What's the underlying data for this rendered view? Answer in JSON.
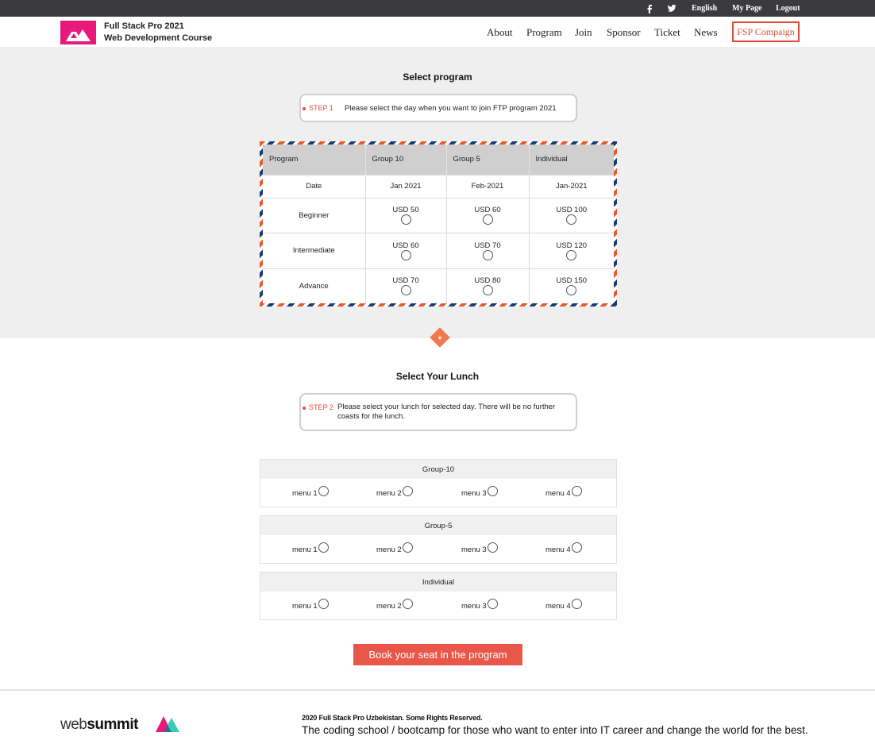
{
  "topbar": {
    "social_icons": [
      "facebook-icon",
      "twitter-icon"
    ],
    "language": "English",
    "my_page": "My Page",
    "logout": "Logout"
  },
  "header": {
    "brand_line1": "Full Stack Pro 2021",
    "brand_line2": "Web Development Course",
    "nav": [
      "About",
      "Program",
      "Join",
      "Sponsor",
      "Ticket",
      "News"
    ],
    "campaign": "FSP Compaign"
  },
  "program": {
    "title": "Select program",
    "step_label": "STEP 1",
    "step_text": "Please select the day when you want to join FTP program 2021",
    "columns": [
      "Program",
      "Group 10",
      "Group 5",
      "Individual"
    ],
    "date_label": "Date",
    "dates": [
      "Jan 2021",
      "Feb-2021",
      "Jan-2021"
    ],
    "rows": [
      {
        "level": "Beginner",
        "prices": [
          "USD 50",
          "USD 60",
          "USD 100"
        ]
      },
      {
        "level": "Intermediate",
        "prices": [
          "USD 60",
          "USD 70",
          "USD 120"
        ]
      },
      {
        "level": "Advance",
        "prices": [
          "USD 70",
          "USD 80",
          "USD 150"
        ]
      }
    ]
  },
  "lunch": {
    "title": "Select Your Lunch",
    "step_label": "STEP 2",
    "step_text_line1": "Please select your lunch for selected day. There will be no further",
    "step_text_line2": "coasts for the lunch.",
    "groups": [
      {
        "name": "Group-10",
        "menus": [
          "menu 1",
          "menu 2",
          "menu 3",
          "menu 4"
        ]
      },
      {
        "name": "Group-5",
        "menus": [
          "menu 1",
          "menu 2",
          "menu 3",
          "menu 4"
        ]
      },
      {
        "name": "Individual",
        "menus": [
          "menu 1",
          "menu 2",
          "menu 3",
          "menu 4"
        ]
      }
    ]
  },
  "book_button": "Book your seat in the program",
  "footer": {
    "logo_light": "web",
    "logo_bold": "summit",
    "copyright": "2020 Full Stack Pro Uzbekistan. Some Rights Reserved.",
    "tagline": "The coding school / bootcamp for those who want to enter into IT career and change the world for the best."
  },
  "colors": {
    "accent": "#e04e3a",
    "brand_pink": "#e8197b",
    "topbar": "#3b3b3f",
    "button": "#e8574a"
  }
}
